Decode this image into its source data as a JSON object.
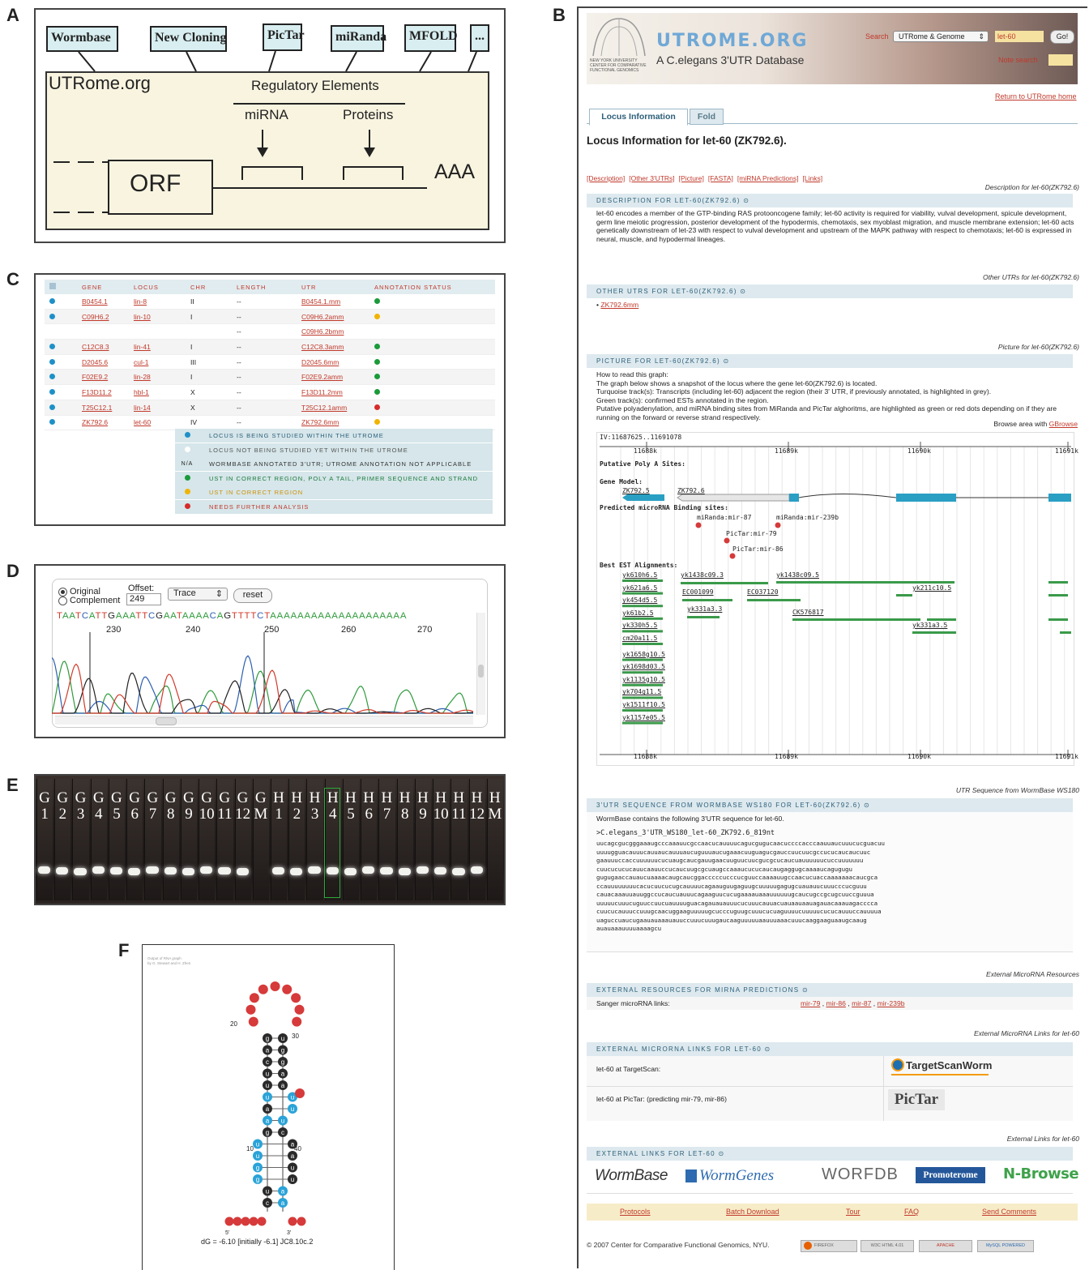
{
  "panels": {
    "a": "A",
    "b": "B",
    "c": "C",
    "d": "D",
    "e": "E",
    "f": "F"
  },
  "panelA": {
    "callouts": [
      "Wormbase",
      "New Cloning",
      "PicTar",
      "miRanda",
      "MFOLD",
      "..."
    ],
    "site": "UTRome.org",
    "reg": "Regulatory Elements",
    "mirna": "miRNA",
    "proteins": "Proteins",
    "orf": "ORF",
    "aaa": "AAA"
  },
  "panelC": {
    "headers": [
      "GENE",
      "LOCUS",
      "CHR",
      "LENGTH",
      "UTR",
      "ANNOTATION STATUS"
    ],
    "rows": [
      {
        "dot": "#1e90c8",
        "gene": "B0454.1",
        "locus": "lin-8",
        "chr": "II",
        "len": "--",
        "utr": "B0454.1.mm",
        "status": "#1a9a3a"
      },
      {
        "dot": "#1e90c8",
        "gene": "C09H6.2",
        "locus": "lin-10",
        "chr": "I",
        "len": "--",
        "utr": "C09H6.2amm",
        "status": "#f0b400"
      },
      {
        "dot": "",
        "gene": "",
        "locus": "",
        "chr": "",
        "len": "--",
        "utr": "C09H6.2bmm",
        "status": ""
      },
      {
        "dot": "#1e90c8",
        "gene": "C12C8.3",
        "locus": "lin-41",
        "chr": "I",
        "len": "--",
        "utr": "C12C8.3amm",
        "status": "#1a9a3a"
      },
      {
        "dot": "#1e90c8",
        "gene": "D2045.6",
        "locus": "cul-1",
        "chr": "III",
        "len": "--",
        "utr": "D2045.6mm",
        "status": "#1a9a3a"
      },
      {
        "dot": "#1e90c8",
        "gene": "F02E9.2",
        "locus": "lin-28",
        "chr": "I",
        "len": "--",
        "utr": "F02E9.2amm",
        "status": "#1a9a3a"
      },
      {
        "dot": "#1e90c8",
        "gene": "F13D11.2",
        "locus": "hbl-1",
        "chr": "X",
        "len": "--",
        "utr": "F13D11.2mm",
        "status": "#1a9a3a"
      },
      {
        "dot": "#1e90c8",
        "gene": "T25C12.1",
        "locus": "lin-14",
        "chr": "X",
        "len": "--",
        "utr": "T25C12.1amm",
        "status": "#d62b2b"
      },
      {
        "dot": "#1e90c8",
        "gene": "ZK792.6",
        "locus": "let-60",
        "chr": "IV",
        "len": "--",
        "utr": "ZK792.6mm",
        "status": "#f0b400"
      }
    ],
    "legend": [
      {
        "key": "dot",
        "color": "#1e90c8",
        "text": "LOCUS IS BEING STUDIED WITHIN THE UTROME",
        "tcolor": "#2d5f7a"
      },
      {
        "key": "dot",
        "color": "#ffffff",
        "text": "LOCUS NOT BEING STUDIED YET WITHIN THE UTROME",
        "tcolor": "#555"
      },
      {
        "key": "N/A",
        "color": "",
        "text": "WORMBASE ANNOTATED 3'UTR; UTROME ANNOTATION NOT APPLICABLE",
        "tcolor": "#333"
      },
      {
        "key": "dot",
        "color": "#1a9a3a",
        "text": "UST IN CORRECT REGION, POLY A TAIL, PRIMER SEQUENCE AND STRAND",
        "tcolor": "#1a7a3a"
      },
      {
        "key": "dot",
        "color": "#f0b400",
        "text": "UST IN CORRECT REGION",
        "tcolor": "#d09000"
      },
      {
        "key": "dot",
        "color": "#d62b2b",
        "text": "NEEDS FURTHER ANALYSIS",
        "tcolor": "#c0392b"
      }
    ]
  },
  "panelD": {
    "original": "Original",
    "complement": "Complement",
    "offset_label": "Offset:",
    "offset_value": "249",
    "mode": "Trace",
    "reset": "reset",
    "sequence": "TAATCATTGAAATTCGAATAAAACAGTTTTCTAAAAAAAAAAAAAAAAAAAA",
    "ticks": [
      "230",
      "240",
      "250",
      "260",
      "270"
    ]
  },
  "panelE": {
    "top": [
      "G",
      "G",
      "G",
      "G",
      "G",
      "G",
      "G",
      "G",
      "G",
      "G",
      "G",
      "G",
      "G",
      "H",
      "H",
      "H",
      "H",
      "H",
      "H",
      "H",
      "H",
      "H",
      "H",
      "H",
      "H",
      "H"
    ],
    "bottom": [
      "1",
      "2",
      "3",
      "4",
      "5",
      "6",
      "7",
      "8",
      "9",
      "10",
      "11",
      "12",
      "M",
      "1",
      "2",
      "3",
      "4",
      "5",
      "6",
      "7",
      "8",
      "9",
      "10",
      "11",
      "12",
      "M"
    ]
  },
  "panelF": {
    "title_small": "Output of RNA graph",
    "subtitle_small": "by G. Stewart and H. Zhen",
    "n20": "20",
    "n30": "30",
    "n10": "10",
    "n40": "40",
    "five": "5'",
    "three": "3'",
    "dg": "dG = -6.10 [initially -6.1] JC8.10c.2"
  },
  "panelB": {
    "site_name": "UTROME.ORG",
    "tagline": "A C.elegans 3'UTR Database",
    "nyu": "NEW YORK UNIVERSITY CENTER FOR COMPARATIVE FUNCTIONAL GENOMICS",
    "search_label": "Search",
    "search_scope": "UTRome & Genome",
    "search_value": "let-60",
    "go": "Go!",
    "note_search": "Note search",
    "return": "Return to UTRome home",
    "tabs": [
      "Locus Information",
      "Fold"
    ],
    "title": "Locus Information for let-60 (ZK792.6).",
    "anchors": [
      "[Description]",
      "[Other 3'UTRs]",
      "[Picture]",
      "[FASTA]",
      "[miRNA Predictions]",
      "[Links]"
    ],
    "desc_sub": "Description for let-60(ZK792.6)",
    "desc_head": "Description for let-60(ZK792.6)",
    "desc_text": "let-60 encodes a member of the GTP-binding RAS protooncogene family; let-60 activity is required for viability, vulval development, spicule development, germ line meiotic progression, posterior development of the hypodermis, chemotaxis, sex myoblast migration, and muscle membrane extension; let-60 acts genetically downstream of let-23 with respect to vulval development and upstream of the MAPK pathway with respect to chemotaxis; let-60 is expressed in neural, muscle, and hypodermal lineages.",
    "other_sub": "Other UTRs for let-60(ZK792.6)",
    "other_head": "Other UTRs for let-60(ZK792.6)",
    "other_item": "ZK792.6mm",
    "pic_sub": "Picture for let-60(ZK792.6)",
    "pic_head": "Picture for let-60(ZK792.6)",
    "pic_lines": [
      "How to read this graph:",
      "The graph below shows a snapshot of the locus where the gene let-60(ZK792.6) is located.",
      "Turquoise track(s): Transcripts (including let-60) adjacent the region (their 3' UTR, if previously annotated, is highlighted in grey).",
      "Green track(s): confirmed ESTs annotated in the region.",
      "Putative polyadenylation, and miRNA binding sites from MiRanda and PicTar alghoritms, are highlighted as green or red dots depending on if they are running on the forward or reverse strand respectively."
    ],
    "browse_area": "Browse area with",
    "gbrowse": "GBrowse",
    "gb": {
      "range": "IV:11687625..11691078",
      "ticks": [
        "11688k",
        "11689k",
        "11690k",
        "11691k"
      ],
      "polya": "Putative Poly A Sites:",
      "gene_model": "Gene Model:",
      "zk5": "ZK792.5",
      "zk6": "ZK792.6",
      "micro": "Predicted microRNA Binding sites:",
      "mir87": "miRanda:mir-87",
      "mir239": "miRanda:mir-239b",
      "mir79": "PicTar:mir-79",
      "mir86": "PicTar:mir-86",
      "est": "Best EST Alignments:",
      "ests": [
        "yk610h6.5",
        "yk621a6.5",
        "yk454d5.5",
        "yk61b2.5",
        "yk330h5.5",
        "cm20a11.5",
        "yk1658g10.5",
        "yk1698d03.5",
        "yk1135g10.5",
        "yk704g11.5",
        "yk1511f10.5",
        "yk1157e05.5"
      ],
      "mid_ests": [
        "yk1438c09.3",
        "EC001099",
        "EC037120",
        "yk331a3.3"
      ],
      "right_ests": [
        "yk1438c09.5",
        "yk211c10.5",
        "CK576817",
        "yk331a3.5"
      ]
    },
    "utr_sub": "UTR Sequence from WormBase WS180",
    "utr_head": "3'UTR sequence from WormBase WS180 for let-60(ZK792.6)",
    "utr_intro": "WormBase contains the following 3'UTR sequence for let-60.",
    "utr_fasta": ">C.elegans_3'UTR_WS180_let-60_ZK792.6_819nt",
    "utr_seq": [
      "uucagcgucgggaaaugcccaaauucgccaacucauuuucagucgugucaacuccccacccaauuaucuuucucguacuu",
      "uuuugguacauuucauuaucauuuaucuguuuaucugaaacuuguagucgauccuucuucgccucucaucaucuuc",
      "gaauuuccaccuuuuuucucuaugcaucgauugaacuuguucuucgucgcucaucuauuuuuucuccuuuuuuu",
      "cuucucucucauucaauuccucaucuugcgcuaugccaaaucucucaucaugaggugcaaaaucagugugu",
      "gugugaaccauaucuaaaacaugcaucggacccccucccucguuccaaaauugccaacucuaccaaaaaaacaucgca",
      "ccauuuuuuuucacucuucucugcauuuucagaauguugaguugcuuuuugagugcuauauucuuucccucguuu",
      "cauacaaauuauuggccucaucuauuucagaaguucucugaaaauaaauuuuuugcaucugccgcugcuuccguuua",
      "uuuuucuuucuguuccuucuauuuuguacagauauauuucucuuucauuacuauaauaauagauacaaauagacccca",
      "cuucucauuuccuuugcaacuggaaguuuuugcucccuguugcuuucucuaguuuucuuuuucucucauuuccauuuua",
      "uaguccuaucugaauauaaauauuccuuucuuugaucaaguuuuuaauuuaaacuuucaaggaaguaaugcaaug",
      "auauaaauuuuaaaagcu"
    ],
    "ext_sub": "External MicroRNA Resources",
    "ext_head": "External resources for miRNA predictions",
    "sanger_label": "Sanger microRNA links:",
    "sanger_links": [
      "mir-79",
      "mir-86",
      "mir-87",
      "mir-239b"
    ],
    "extlinks_sub": "External MicroRNA Links for let-60",
    "extlinks_head": "External microRNA links for let-60",
    "targetscan_label": "let-60 at TargetScan:",
    "targetscan_logo": "TargetScanWorm",
    "pictar_label": "let-60 at PicTar: (predicting mir-79, mir-86)",
    "pictar_logo": "PicTar",
    "extl_sub": "External Links for let-60",
    "extl_head": "External links for let-60",
    "logos": [
      "WormBase",
      "WormGenes",
      "WORFDB",
      "Promoterome",
      "N-Browse"
    ],
    "footer_links": [
      "Protocols",
      "Batch Download",
      "Tour",
      "FAQ",
      "Send Comments"
    ],
    "copyright": "© 2007 Center for Comparative Functional Genomics, NYU.",
    "badges": [
      "FIREFOX",
      "W3C HTML 4.01",
      "APACHE",
      "MySQL POWERED"
    ]
  }
}
